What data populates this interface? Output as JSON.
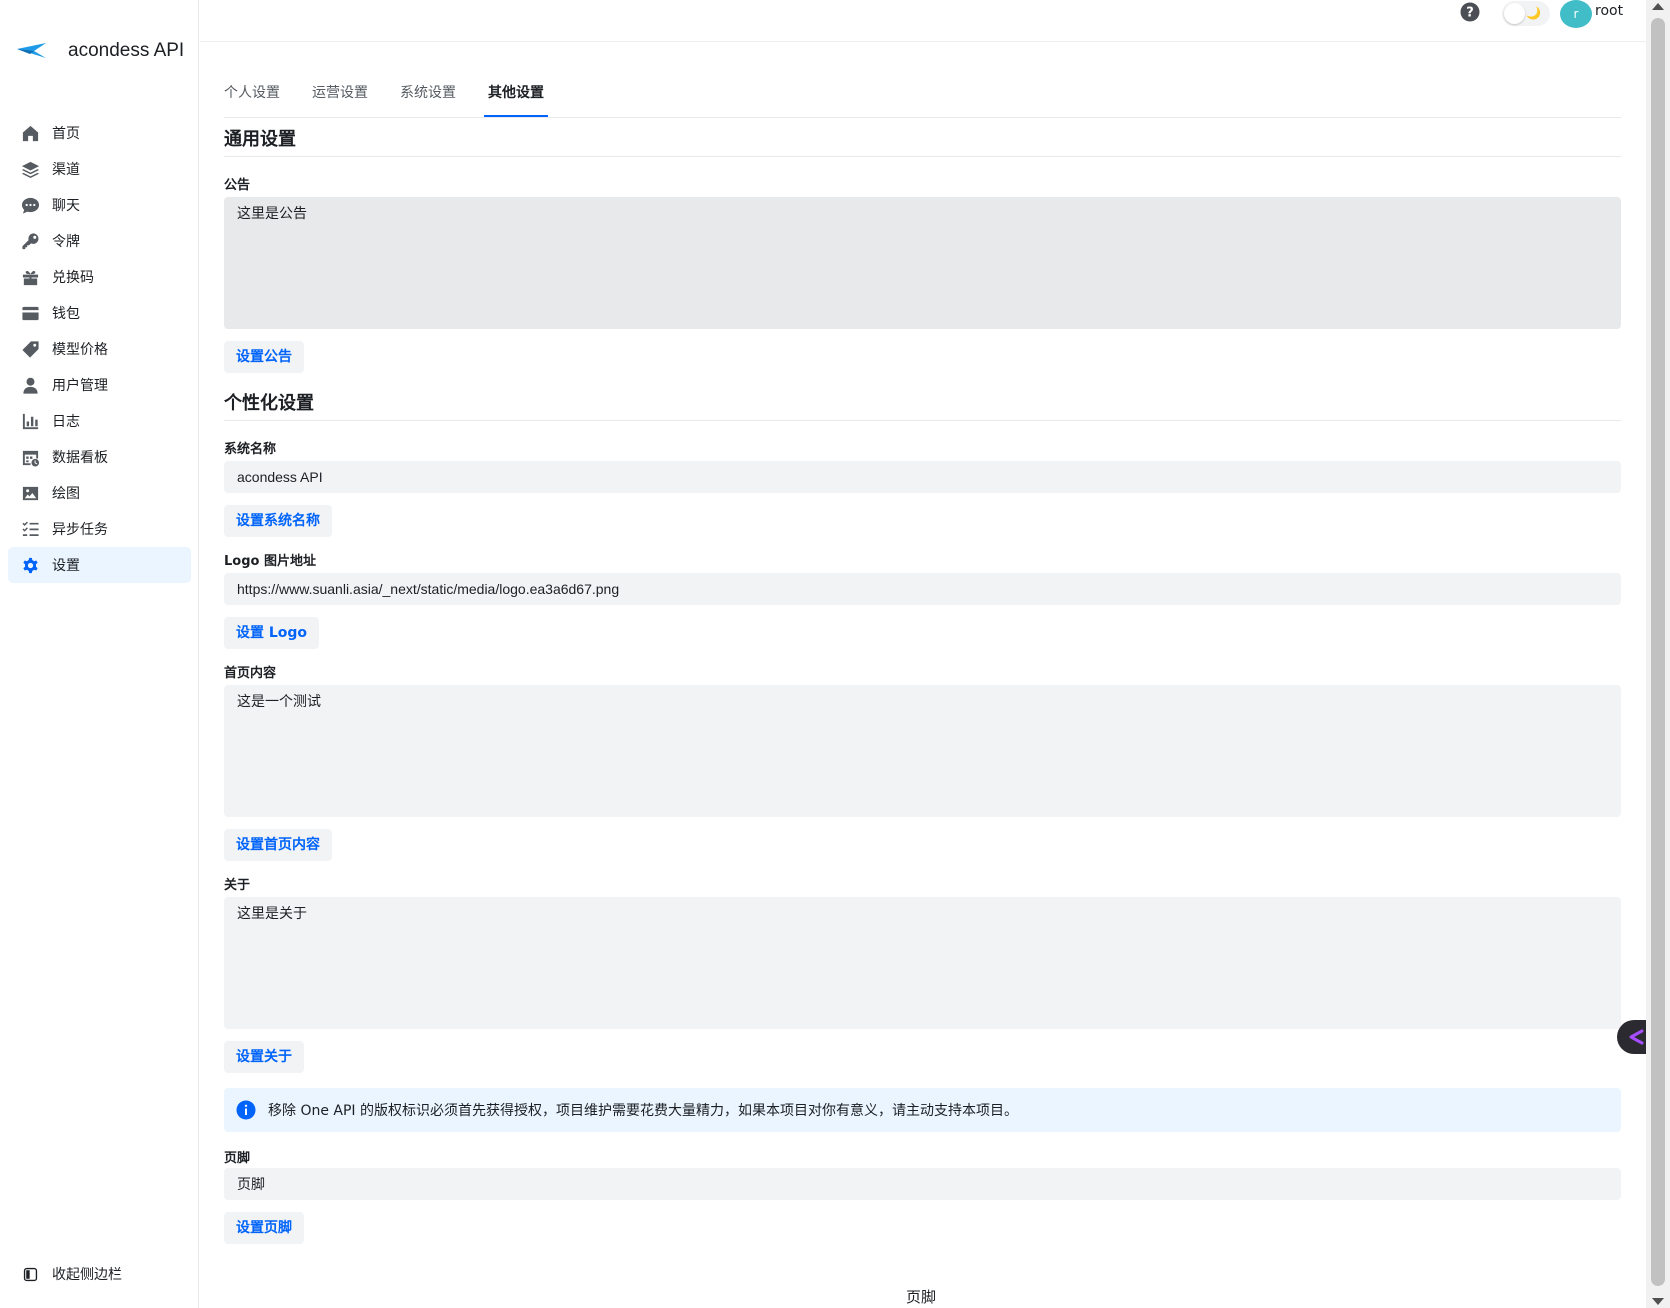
{
  "brand": {
    "name": "acondess API"
  },
  "sidebar": {
    "items": [
      {
        "label": "首页",
        "icon": "home-icon"
      },
      {
        "label": "渠道",
        "icon": "layers-icon"
      },
      {
        "label": "聊天",
        "icon": "chat-icon"
      },
      {
        "label": "令牌",
        "icon": "key-icon"
      },
      {
        "label": "兑换码",
        "icon": "gift-icon"
      },
      {
        "label": "钱包",
        "icon": "credit-card-icon"
      },
      {
        "label": "模型价格",
        "icon": "price-tag-icon"
      },
      {
        "label": "用户管理",
        "icon": "user-icon"
      },
      {
        "label": "日志",
        "icon": "bar-chart-icon"
      },
      {
        "label": "数据看板",
        "icon": "dashboard-icon"
      },
      {
        "label": "绘图",
        "icon": "image-icon"
      },
      {
        "label": "异步任务",
        "icon": "task-list-icon"
      },
      {
        "label": "设置",
        "icon": "gear-icon",
        "active": true
      }
    ],
    "collapse_label": "收起侧边栏"
  },
  "header": {
    "avatar_initial": "r",
    "username": "root",
    "theme_moon": "🌙"
  },
  "tabs": [
    {
      "label": "个人设置"
    },
    {
      "label": "运营设置"
    },
    {
      "label": "系统设置"
    },
    {
      "label": "其他设置",
      "active": true
    }
  ],
  "general": {
    "title": "通用设置",
    "notice_label": "公告",
    "notice_value": "这里是公告",
    "notice_button": "设置公告"
  },
  "personalization": {
    "title": "个性化设置",
    "system_name_label": "系统名称",
    "system_name_value": "acondess API",
    "system_name_button": "设置系统名称",
    "logo_label": "Logo 图片地址",
    "logo_value": "https://www.suanli.asia/_next/static/media/logo.ea3a6d67.png",
    "logo_button": "设置 Logo",
    "home_label": "首页内容",
    "home_value": "这是一个测试",
    "home_button": "设置首页内容",
    "about_label": "关于",
    "about_value": "这里是关于",
    "about_button": "设置关于",
    "banner_text": "移除 One API 的版权标识必须首先获得授权，项目维护需要花费大量精力，如果本项目对你有意义，请主动支持本项目。",
    "footer_label": "页脚",
    "footer_value": "页脚",
    "footer_button": "设置页脚"
  },
  "page_footer": "页脚",
  "colors": {
    "accent": "#0064fa",
    "active_bg": "#eaf5ff",
    "input_bg": "#f2f3f5",
    "avatar_bg": "#40bdc7"
  }
}
